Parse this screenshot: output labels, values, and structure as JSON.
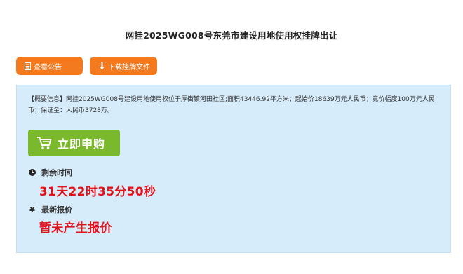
{
  "page": {
    "title": "网挂2025WG008号东莞市建设用地使用权挂牌出让"
  },
  "toolbar": {
    "notice_label": "查看公告",
    "download_label": "下载挂牌文件",
    "notice_icon": "document-icon",
    "download_icon": "download-arrow-icon",
    "button_color": "#f47a1f"
  },
  "panel": {
    "summary": "【概要信息】网挂2025WG008号建设用地使用权位于厚街镇河田社区;面积43446.92平方米；起始价18639万元人民币；竞价幅度100万元人民币；保证金：人民币3728万。",
    "background_color": "#d7ecfb",
    "apply_label": "立即申购",
    "apply_icon": "cart-icon",
    "apply_color": "#7ab82c",
    "remaining_label": "剩余时间",
    "remaining_icon": "clock-icon",
    "countdown": "31天22时35分50秒",
    "price_label": "最新报价",
    "price_icon": "yen-icon",
    "price_value": "暂未产生报价",
    "highlight_color": "#e0141c"
  }
}
